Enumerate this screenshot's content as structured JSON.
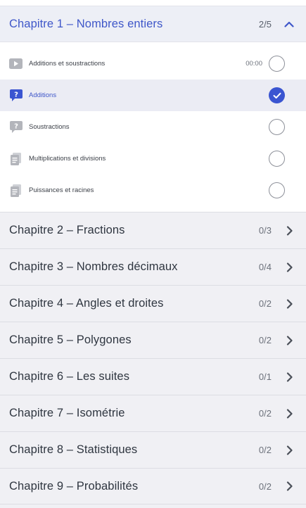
{
  "open_chapter": {
    "title": "Chapitre 1 – Nombres entiers",
    "progress": "2/5",
    "accent": "#3f57c9",
    "lessons": [
      {
        "label": "Additions et soustractions",
        "icon": "video-icon",
        "duration": "00:00",
        "done": false,
        "active": false
      },
      {
        "label": "Additions",
        "icon": "quiz-icon",
        "duration": "",
        "done": true,
        "active": true
      },
      {
        "label": "Soustractions",
        "icon": "quiz-icon",
        "duration": "",
        "done": false,
        "active": false
      },
      {
        "label": "Multiplications et divisions",
        "icon": "document-icon",
        "duration": "",
        "done": false,
        "active": false
      },
      {
        "label": "Puissances et racines",
        "icon": "document-icon",
        "duration": "",
        "done": false,
        "active": false
      }
    ]
  },
  "chapters": [
    {
      "title": "Chapitre 2 – Fractions",
      "progress": "0/3"
    },
    {
      "title": "Chapitre 3 – Nombres décimaux",
      "progress": "0/4"
    },
    {
      "title": "Chapitre 4 – Angles et droites",
      "progress": "0/2"
    },
    {
      "title": "Chapitre 5 – Polygones",
      "progress": "0/2"
    },
    {
      "title": "Chapitre 6 – Les suites",
      "progress": "0/1"
    },
    {
      "title": "Chapitre 7 – Isométrie",
      "progress": "0/2"
    },
    {
      "title": "Chapitre 8 – Statistiques",
      "progress": "0/2"
    },
    {
      "title": "Chapitre 9 – Probabilités",
      "progress": "0/2"
    }
  ]
}
